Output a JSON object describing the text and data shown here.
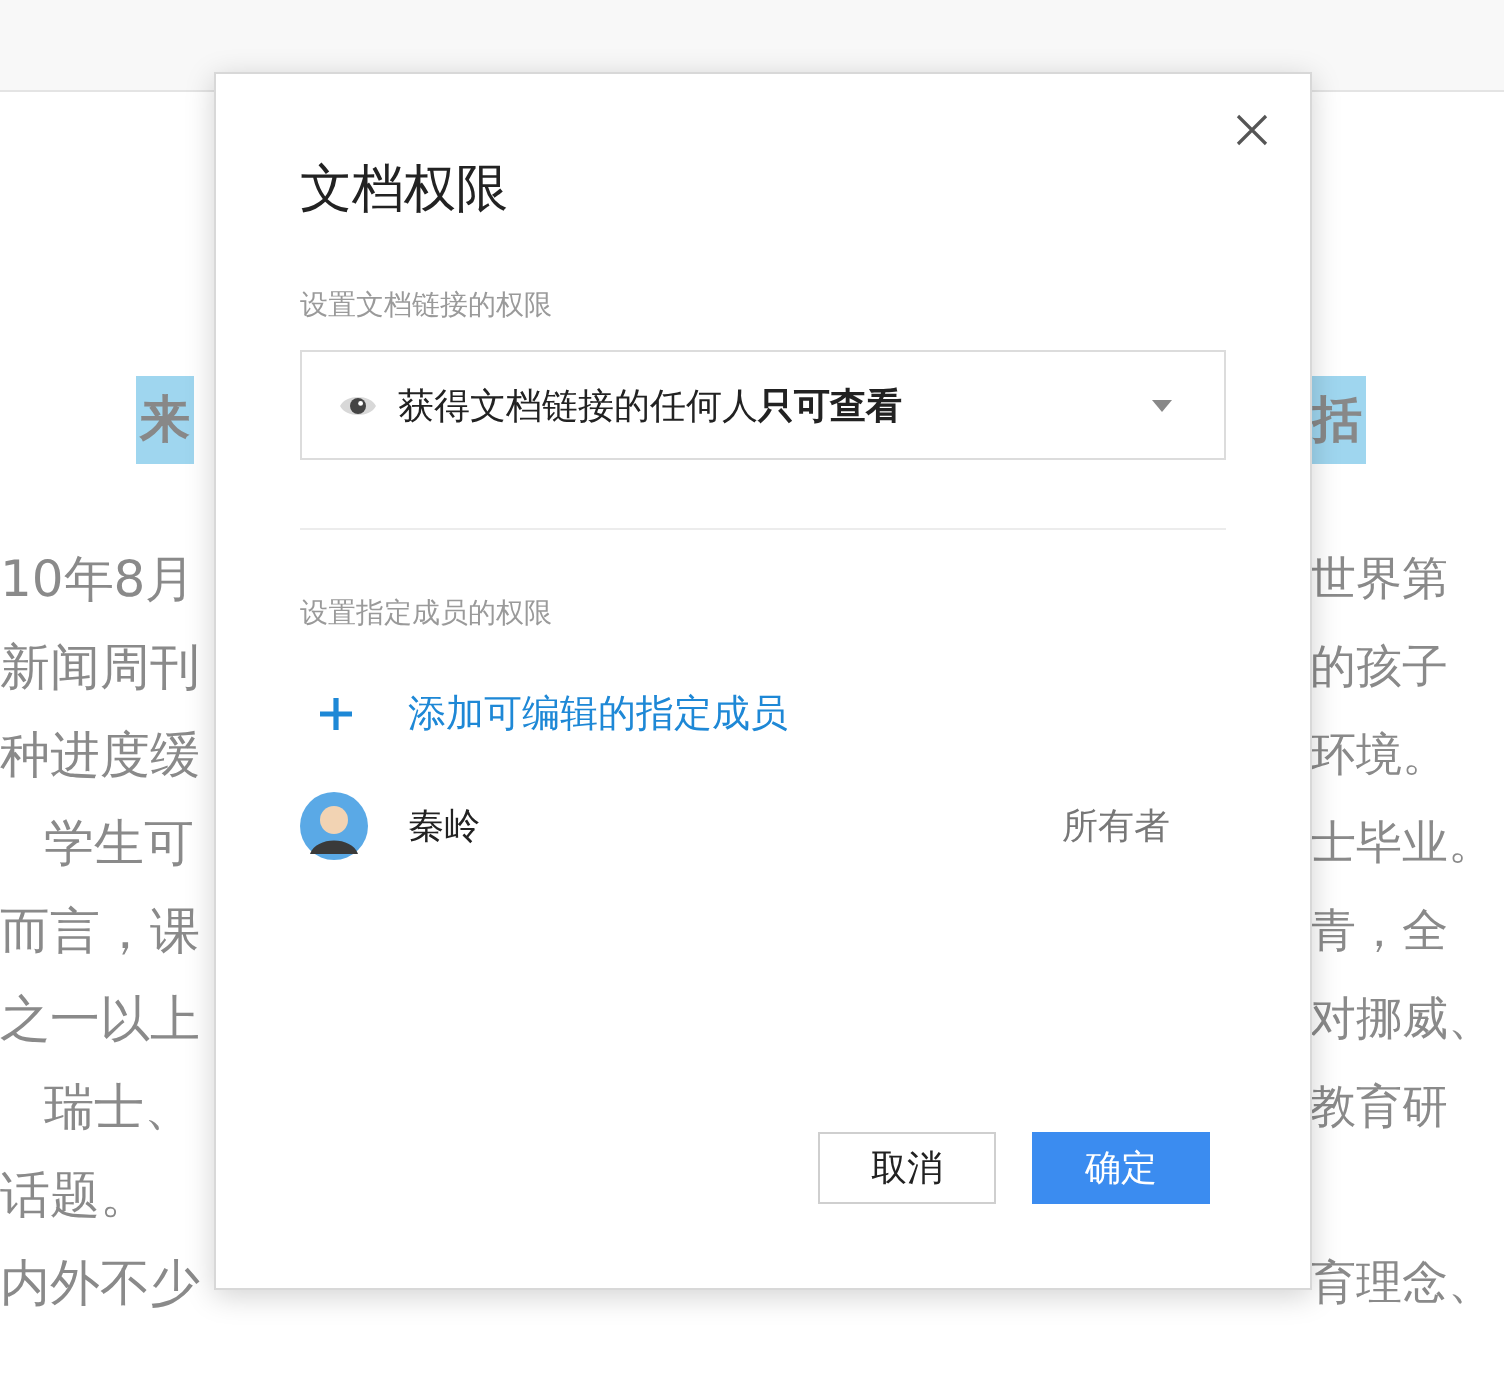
{
  "document": {
    "heading": {
      "left": "来",
      "right": "括"
    },
    "lines": [
      {
        "left": "10年8月",
        "right": "世界第",
        "indent": false
      },
      {
        "left": "新闻周刊",
        "right": "的孩子",
        "indent": false
      },
      {
        "left": "种进度缓",
        "right": "环境。",
        "indent": false
      },
      {
        "left": "学生可",
        "right": "士毕业。",
        "indent": true
      },
      {
        "left": "而言，课",
        "right": "青，全",
        "indent": false
      },
      {
        "left": "之一以上",
        "right": "对挪威、",
        "indent": false
      },
      {
        "left": "瑞士、",
        "right": "教育研",
        "indent": true
      },
      {
        "left": "话题。",
        "indent": false
      },
      {
        "left": "内外不少",
        "right": "育理念、",
        "indent": false
      }
    ]
  },
  "dialog": {
    "title": "文档权限",
    "link_section": {
      "label": "设置文档链接的权限",
      "select": {
        "value": "获得文档链接的任何人**只可查看**"
      }
    },
    "member_section": {
      "label": "设置指定成员的权限",
      "add": "添加可编辑的指定成员",
      "members": [
        {
          "name": "秦岭",
          "role": "所有者"
        }
      ]
    },
    "buttons": [
      {
        "label": "取消",
        "kind": "secondary"
      },
      {
        "label": "确定",
        "kind": "primary"
      }
    ]
  }
}
